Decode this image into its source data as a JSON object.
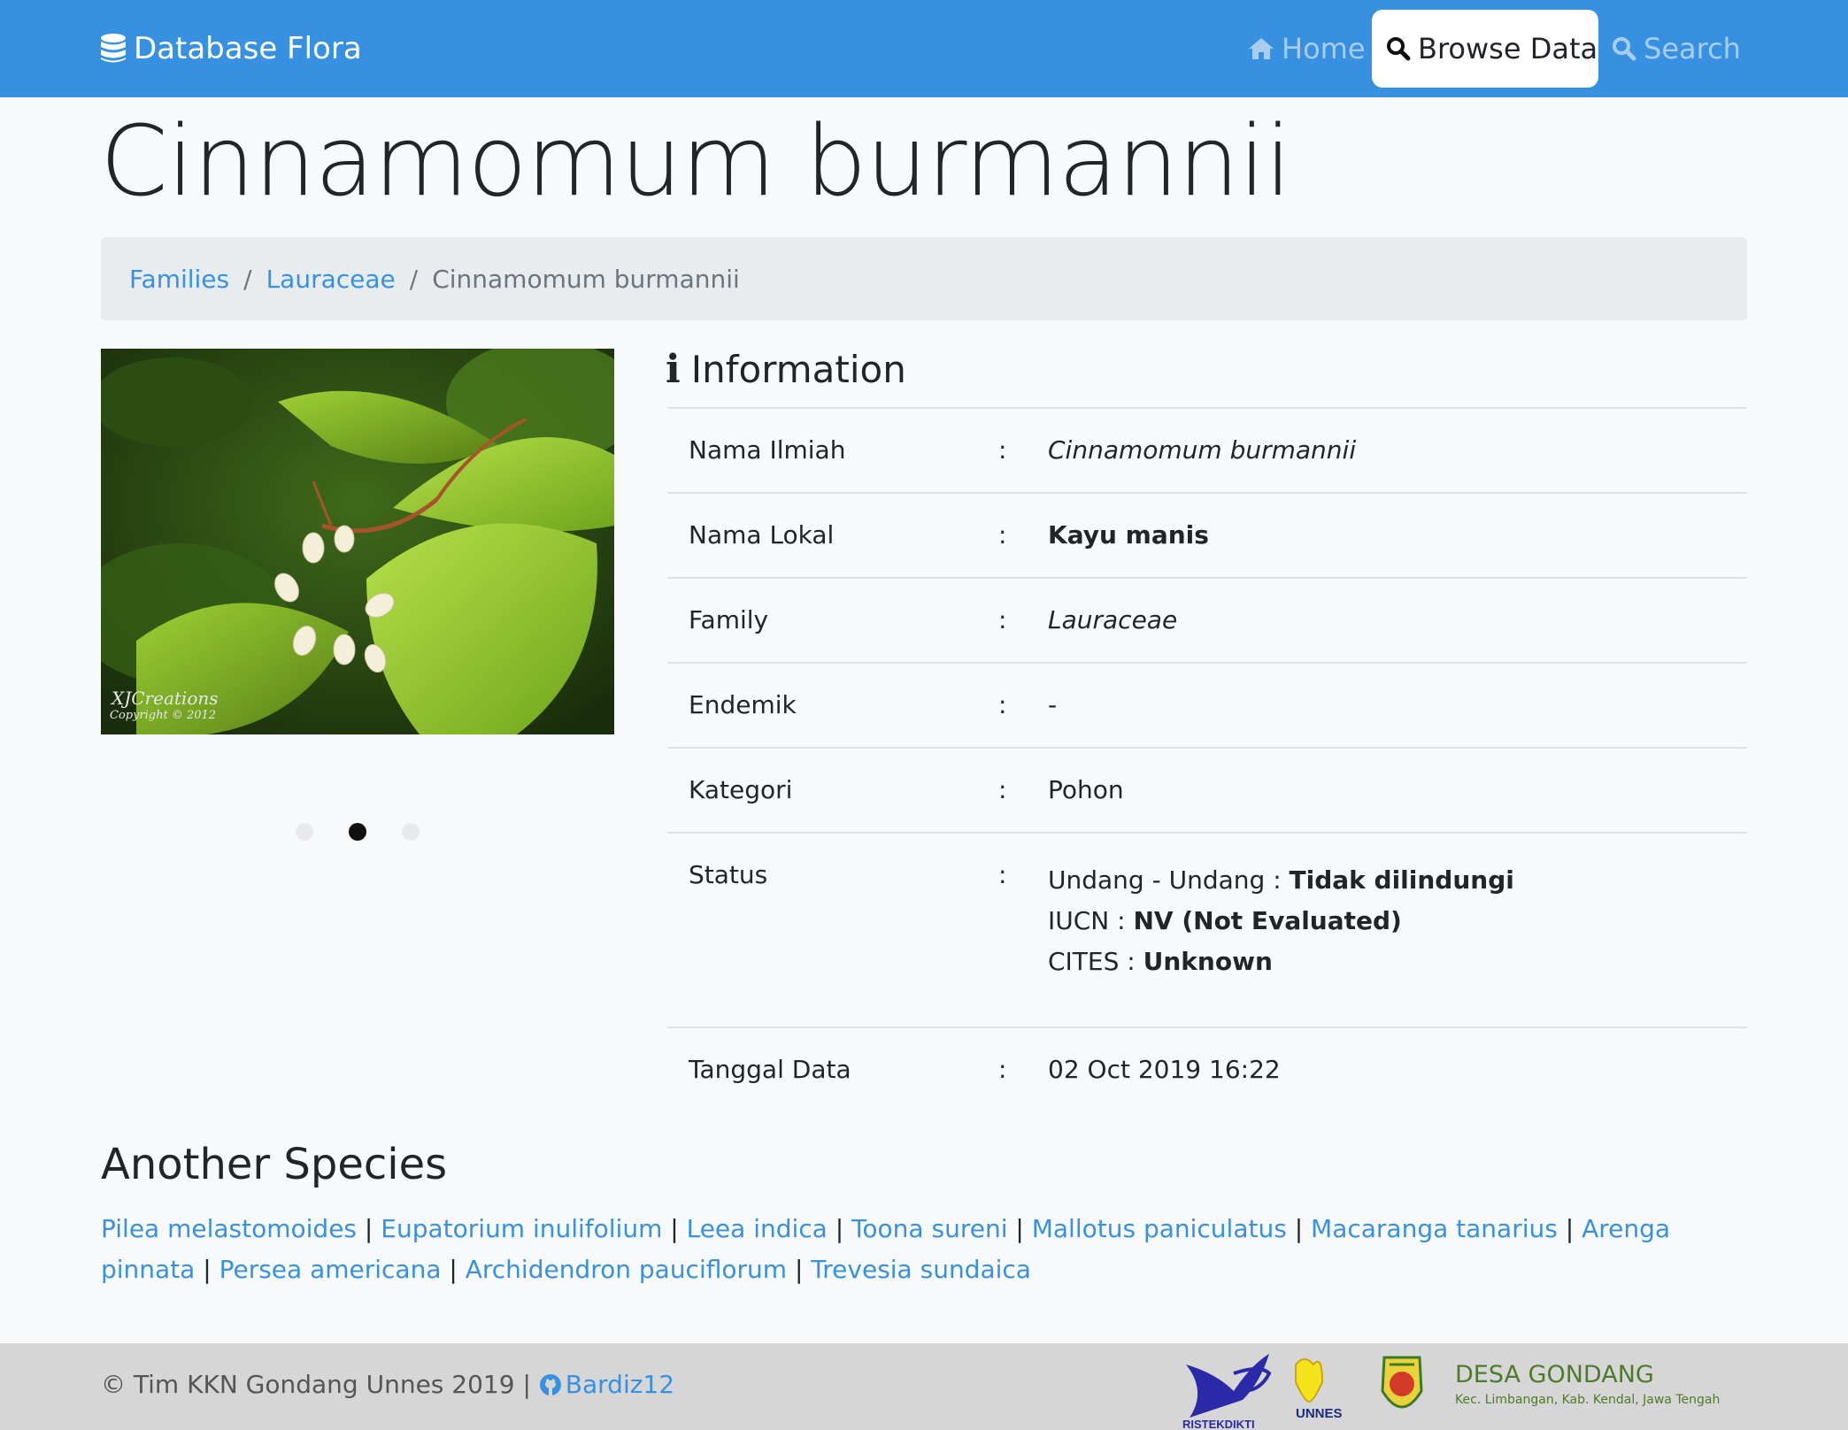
{
  "nav": {
    "brand": "Database Flora",
    "home": "Home",
    "browse": "Browse Data",
    "search": "Search"
  },
  "title": "Cinnamomum burmannii",
  "breadcrumb": {
    "families": "Families",
    "family": "Lauraceae",
    "current": "Cinnamomum burmannii"
  },
  "carousel": {
    "active_index": 1,
    "count": 3,
    "watermark_line1": "XJCreations",
    "watermark_line2": "Copyright © 2012"
  },
  "information": {
    "heading": "Information",
    "rows": {
      "nama_ilmiah": {
        "label": "Nama Ilmiah",
        "value": "Cinnamomum burmannii"
      },
      "nama_lokal": {
        "label": "Nama Lokal",
        "value": "Kayu manis"
      },
      "family": {
        "label": "Family",
        "value": "Lauraceae"
      },
      "endemik": {
        "label": "Endemik",
        "value": "-"
      },
      "kategori": {
        "label": "Kategori",
        "value": "Pohon"
      },
      "status": {
        "label": "Status",
        "uu_label": "Undang - Undang : ",
        "uu_value": "Tidak dilindungi",
        "iucn_label": "IUCN : ",
        "iucn_value": "NV (Not Evaluated)",
        "cites_label": "CITES : ",
        "cites_value": "Unknown"
      },
      "tanggal": {
        "label": "Tanggal Data",
        "value": "02 Oct 2019 16:22"
      }
    },
    "colon": ":"
  },
  "another": {
    "heading": "Another Species",
    "separator": " | ",
    "species": [
      "Pilea melastomoides",
      "Eupatorium inulifolium",
      "Leea indica",
      "Toona sureni",
      "Mallotus paniculatus",
      "Macaranga tanarius",
      "Arenga pinnata",
      "Persea americana",
      "Archidendron pauciflorum",
      "Trevesia sundaica"
    ]
  },
  "footer": {
    "copyright": "© Tim KKN Gondang Unnes 2019 | ",
    "github_user": "Bardiz12",
    "logo_ristekdikti": "RISTEKDIKTI",
    "logo_unnes": "UNNES",
    "desa_name": "DESA GONDANG",
    "desa_sub": "Kec. Limbangan, Kab. Kendal, Jawa Tengah"
  },
  "colors": {
    "navbar": "#3791e0",
    "link": "#3791e0",
    "footer_bg": "#d6d6d6",
    "desa_green": "#4e7a2b"
  }
}
